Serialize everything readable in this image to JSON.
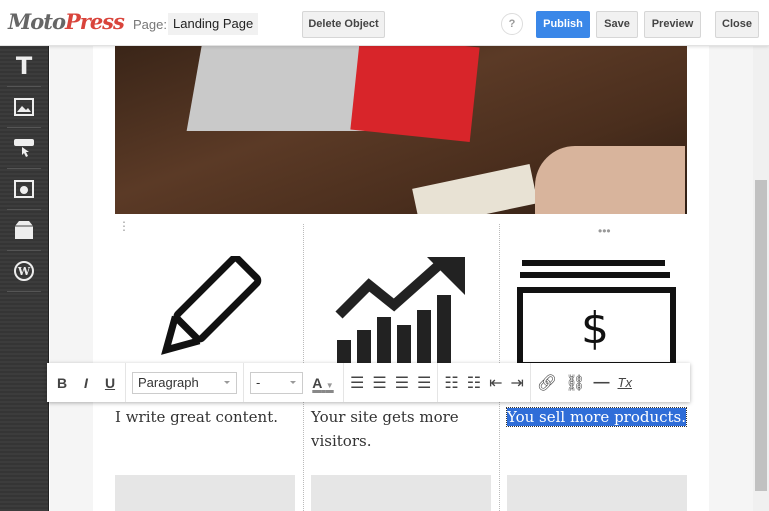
{
  "header": {
    "logo_part1": "Moto",
    "logo_part2": "Press",
    "page_label": "Page:",
    "page_name": "Landing Page",
    "delete_object": "Delete Object",
    "help": "?",
    "publish": "Publish",
    "save": "Save",
    "preview": "Preview",
    "close": "Close",
    "accent": "#3a87e8"
  },
  "sidebar": {
    "items": [
      {
        "icon": "text-icon"
      },
      {
        "icon": "image-icon"
      },
      {
        "icon": "button-click-icon"
      },
      {
        "icon": "video-icon"
      },
      {
        "icon": "box-icon"
      },
      {
        "icon": "wordpress-icon"
      }
    ]
  },
  "toolbar": {
    "bold": "B",
    "italic": "I",
    "underline": "U",
    "format": "Paragraph",
    "size": "-",
    "color": "A",
    "clear": "Tx"
  },
  "columns": [
    {
      "text": "I write great content.",
      "icon": "pencil-icon"
    },
    {
      "text": "Your site gets more visitors.",
      "icon": "growth-chart-icon"
    },
    {
      "text": "You sell more products.",
      "icon": "money-icon"
    }
  ]
}
